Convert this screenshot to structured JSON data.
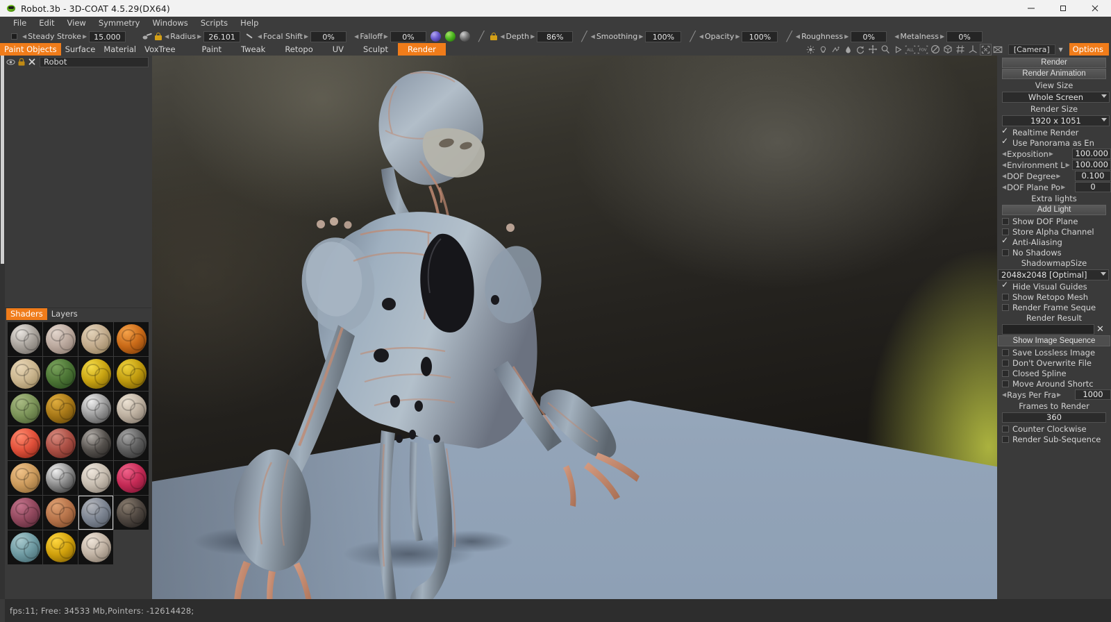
{
  "window": {
    "title": "Robot.3b - 3D-COAT 4.5.29(DX64)",
    "app_icon": "robot-green-icon",
    "minimize": "minimize-icon",
    "maximize": "maximize-icon",
    "close": "close-icon"
  },
  "menubar": {
    "items": [
      {
        "label": "File"
      },
      {
        "label": "Edit"
      },
      {
        "label": "View"
      },
      {
        "label": "Symmetry"
      },
      {
        "label": "Windows"
      },
      {
        "label": "Scripts"
      },
      {
        "label": "Help"
      }
    ]
  },
  "brushbar": {
    "params": [
      {
        "name": "Steady Stroke",
        "value": "15.000"
      },
      {
        "name": "Radius",
        "value": "26.101"
      },
      {
        "name": "Focal Shift",
        "value": "0%"
      },
      {
        "name": "Falloff",
        "value": "0%"
      },
      {
        "name": "Depth",
        "value": "86%"
      },
      {
        "name": "Smoothing",
        "value": "100%"
      },
      {
        "name": "Opacity",
        "value": "100%"
      },
      {
        "name": "Roughness",
        "value": "0%"
      },
      {
        "name": "Metalness",
        "value": "0%"
      }
    ]
  },
  "tabs": {
    "left_group": [
      {
        "label": "Paint Objects",
        "active": true
      },
      {
        "label": "Surface",
        "active": false
      },
      {
        "label": "Material",
        "active": false
      },
      {
        "label": "VoxTree",
        "active": false
      }
    ],
    "room_group": [
      {
        "label": "Paint",
        "active": false
      },
      {
        "label": "Tweak",
        "active": false
      },
      {
        "label": "Retopo",
        "active": false
      },
      {
        "label": "UV",
        "active": false
      },
      {
        "label": "Sculpt",
        "active": false
      },
      {
        "label": "Render",
        "active": true
      }
    ],
    "viewport_icons": [
      "sun-light-icon",
      "bulb-light-icon",
      "reflection-icon",
      "drop-icon",
      "rotate-icon",
      "move-icon",
      "zoom-icon",
      "play-icon",
      "all-frame-icon",
      "fov-icon",
      "no-icon",
      "cage-icon",
      "grid-icon",
      "axis-icon",
      "fit-screen-icon",
      "flat-icon"
    ],
    "camera_label": "[Camera]",
    "camera_chevron": "chevron-down-icon",
    "options_label": "Options"
  },
  "left_panel": {
    "object_tabs": [
      {
        "label": "Paint Objects",
        "active": true
      },
      {
        "label": "Surface",
        "active": false
      },
      {
        "label": "Material",
        "active": false
      },
      {
        "label": "VoxTree",
        "active": false
      }
    ],
    "object_row": {
      "eye_icon": "eye-visibility-icon",
      "lock_icon": "lock-icon",
      "close_icon": "remove-x-icon",
      "name": "Robot"
    },
    "bottom_tabs": [
      {
        "label": "Shaders",
        "active": true
      },
      {
        "label": "Layers",
        "active": false
      }
    ],
    "shaders": [
      {
        "name": "shader-1",
        "c1": "#e8e4df",
        "c2": "#a9a39c",
        "c3": "#67625c",
        "selected": false
      },
      {
        "name": "shader-2",
        "c1": "#e3d6cd",
        "c2": "#bba99e",
        "c3": "#7d6d63",
        "selected": false
      },
      {
        "name": "shader-3",
        "c1": "#e2d2b9",
        "c2": "#c2ab8c",
        "c3": "#86734f",
        "selected": false
      },
      {
        "name": "shader-4",
        "c1": "#f5a24a",
        "c2": "#c96a18",
        "c3": "#6a3207",
        "selected": false
      },
      {
        "name": "shader-5",
        "c1": "#e8d6b6",
        "c2": "#cbb68f",
        "c3": "#8e7a53",
        "selected": false
      },
      {
        "name": "shader-6",
        "c1": "#7aa35c",
        "c2": "#4c7535",
        "c3": "#22401a",
        "selected": false
      },
      {
        "name": "shader-7",
        "c1": "#f5dc4a",
        "c2": "#c9a412",
        "c3": "#6b5404",
        "selected": false
      },
      {
        "name": "shader-8",
        "c1": "#f0d23a",
        "c2": "#bf9a0e",
        "c3": "#5f4a03",
        "selected": false
      },
      {
        "name": "shader-9",
        "c1": "#a9bb84",
        "c2": "#7b9358",
        "c3": "#41532c",
        "selected": false
      },
      {
        "name": "shader-10",
        "c1": "#e0ad3e",
        "c2": "#a77818",
        "c3": "#553b06",
        "selected": false
      },
      {
        "name": "shader-11",
        "c1": "#efefef",
        "c2": "#9a9a9a",
        "c3": "#3e3e3e",
        "selected": false
      },
      {
        "name": "shader-12",
        "c1": "#ece2d3",
        "c2": "#bdb0a0",
        "c3": "#6e645a",
        "selected": false
      },
      {
        "name": "shader-13",
        "c1": "#ff8a6e",
        "c2": "#e0503a",
        "c3": "#7a1f12",
        "selected": false
      },
      {
        "name": "shader-14",
        "c1": "#d98a7e",
        "c2": "#ab4f44",
        "c3": "#5c221c",
        "selected": false
      },
      {
        "name": "shader-15",
        "c1": "#b5b0ab",
        "c2": "#55514d",
        "c3": "#1c1a19",
        "selected": false
      },
      {
        "name": "shader-16",
        "c1": "#a8a8a8",
        "c2": "#5d5d5d",
        "c3": "#252525",
        "selected": false
      },
      {
        "name": "shader-17",
        "c1": "#f0c289",
        "c2": "#cb9a5c",
        "c3": "#7d5c2f",
        "selected": false
      },
      {
        "name": "shader-18",
        "c1": "#f0f0f0",
        "c2": "#8b8b8b",
        "c3": "#202020",
        "selected": false
      },
      {
        "name": "shader-19",
        "c1": "#eee6dc",
        "c2": "#c6bcaf",
        "c3": "#7a7167",
        "selected": false
      },
      {
        "name": "shader-20",
        "c1": "#f0628a",
        "c2": "#c42a55",
        "c3": "#69102a",
        "selected": false
      },
      {
        "name": "shader-21",
        "c1": "#c4748c",
        "c2": "#91485d",
        "c3": "#4c2230",
        "selected": false
      },
      {
        "name": "shader-22",
        "c1": "#e0a172",
        "c2": "#b6734a",
        "c3": "#6b3f21",
        "selected": false
      },
      {
        "name": "shader-23",
        "c1": "#b5b7bd",
        "c2": "#7c8491",
        "c3": "#474d57",
        "selected": true
      },
      {
        "name": "shader-24",
        "c1": "#8b7e70",
        "c2": "#4e4640",
        "c3": "#1c1917",
        "selected": false
      },
      {
        "name": "shader-25",
        "c1": "#a8c9cd",
        "c2": "#6e9aa2",
        "c3": "#3b5c63",
        "selected": false
      },
      {
        "name": "shader-26",
        "c1": "#ffd740",
        "c2": "#d0a00c",
        "c3": "#6d5103",
        "selected": false
      },
      {
        "name": "shader-27",
        "c1": "#eee4d8",
        "c2": "#c1b3a4",
        "c3": "#75695c",
        "selected": false
      }
    ]
  },
  "right_panel": {
    "title": "Options",
    "render_button": "Render",
    "render_animation_button": "Render Animation",
    "view_size_label": "View Size",
    "view_size_value": "Whole Screen",
    "render_size_label": "Render Size",
    "render_size_value": "1920 x 1051",
    "checks_top": [
      {
        "label": "Realtime Render",
        "checked": true
      },
      {
        "label": "Use Panorama as En",
        "checked": true
      }
    ],
    "params": [
      {
        "name": "Exposition",
        "value": "100.000"
      },
      {
        "name": "Environment L",
        "value": "100.000"
      },
      {
        "name": "DOF Degree",
        "value": "0.100"
      },
      {
        "name": "DOF Plane Po",
        "value": "0"
      }
    ],
    "extra_lights_label": "Extra lights",
    "add_light_button": "Add Light",
    "checks_mid": [
      {
        "label": "Show DOF Plane",
        "checked": false
      },
      {
        "label": "Store Alpha Channel",
        "checked": false
      },
      {
        "label": "Anti-Aliasing",
        "checked": true
      },
      {
        "label": "No Shadows",
        "checked": false
      }
    ],
    "shadowmap_label": "ShadowmapSize",
    "shadowmap_value": "2048x2048 [Optimal]",
    "checks_mid2": [
      {
        "label": "Hide Visual Guides",
        "checked": true
      },
      {
        "label": "Show Retopo Mesh",
        "checked": false
      },
      {
        "label": "Render Frame Seque",
        "checked": false
      }
    ],
    "render_result_label": "Render Result",
    "render_result_value": "",
    "render_result_clear": "clear-x-icon",
    "show_image_sequence_button": "Show Image Sequence",
    "checks_bottom": [
      {
        "label": "Save Lossless Image",
        "checked": false
      },
      {
        "label": "Don't Overwrite File",
        "checked": false
      },
      {
        "label": "Closed Spline",
        "checked": false
      },
      {
        "label": "Move Around Shortc",
        "checked": false
      }
    ],
    "rays_param": {
      "name": "Rays Per Fra",
      "value": "1000"
    },
    "frames_label": "Frames to Render",
    "frames_value": "360",
    "checks_last": [
      {
        "label": "Counter Clockwise",
        "checked": false
      },
      {
        "label": "Render Sub-Sequence",
        "checked": false
      }
    ]
  },
  "statusbar": {
    "text": "fps:11;    Free: 34533 Mb,Pointers: -12614428;"
  },
  "colors": {
    "accent": "#f07c1a",
    "panel": "#3a3a3a",
    "toolbar": "#3c3c3c",
    "field": "#2b2b2b",
    "text": "#d2d2d2"
  }
}
